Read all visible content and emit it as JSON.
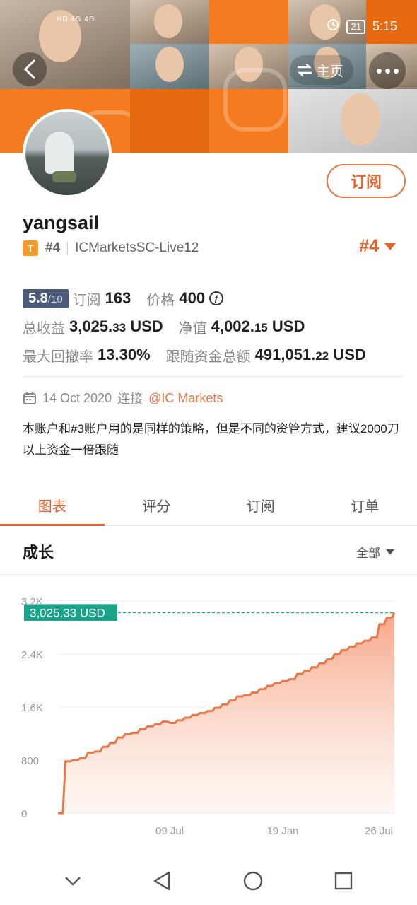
{
  "status_bar": {
    "network_left": "HD 4G 4G",
    "battery": "21",
    "time": "5:15"
  },
  "header": {
    "home_label": "主页"
  },
  "profile": {
    "subscribe_button": "订阅",
    "username": "yangsail",
    "tier_badge": "T",
    "rank": "#4",
    "server": "ICMarketsSC-Live12",
    "rank_right": "#4"
  },
  "stats": {
    "score": "5.8",
    "score_max": "/10",
    "subscribers_label": "订阅",
    "subscribers": "163",
    "price_label": "价格",
    "price": "400",
    "currency_icon": "ƒ",
    "total_profit_label": "总收益",
    "total_profit_main": "3,025.",
    "total_profit_dec": "33",
    "total_profit_unit": "USD",
    "equity_label": "净值",
    "equity_main": "4,002.",
    "equity_dec": "15",
    "equity_unit": "USD",
    "max_drawdown_label": "最大回撤率",
    "max_drawdown": "13.30%",
    "follow_funds_label": "跟随资金总额",
    "follow_funds_main": "491,051.",
    "follow_funds_dec": "22",
    "follow_funds_unit": "USD"
  },
  "connection": {
    "date": "14 Oct 2020",
    "connect_label": "连接",
    "broker": "@IC Markets"
  },
  "description": "本账户和#3账户用的是同样的策略，但是不同的资管方式，建议2000刀以上资金一倍跟随",
  "tabs": [
    "图表",
    "评分",
    "订阅",
    "订单"
  ],
  "section": {
    "title": "成长",
    "range": "全部"
  },
  "chart_data": {
    "type": "area",
    "ylim": [
      0,
      3200
    ],
    "yticks": [
      "3.2K",
      "2.4K",
      "1.6K",
      "800",
      "0"
    ],
    "ytick_values": [
      3200,
      2400,
      1600,
      800,
      0
    ],
    "xticks": [
      "09 Jul",
      "19 Jan",
      "26 Jul"
    ],
    "current_label": "3,025.33 USD",
    "current_value": 3025.33,
    "values": [
      0,
      780,
      800,
      830,
      910,
      930,
      1000,
      1060,
      1140,
      1190,
      1210,
      1270,
      1310,
      1340,
      1380,
      1360,
      1400,
      1440,
      1480,
      1510,
      1540,
      1590,
      1640,
      1700,
      1760,
      1780,
      1820,
      1870,
      1920,
      1960,
      1990,
      2020,
      2100,
      2150,
      2200,
      2260,
      2320,
      2400,
      2460,
      2510,
      2560,
      2600,
      2650,
      2850,
      2950,
      3025.33
    ]
  },
  "colors": {
    "accent": "#e8622e",
    "teal": "#1aa58a",
    "score_bg": "#4a5a78"
  }
}
